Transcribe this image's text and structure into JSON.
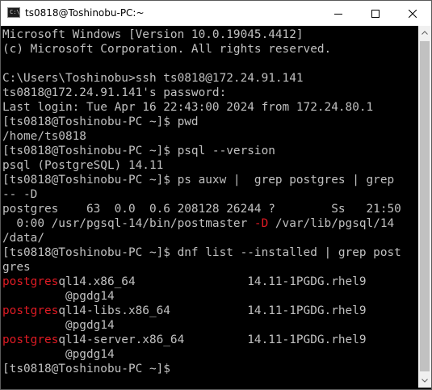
{
  "window": {
    "title": "ts0818@Toshinobu-PC:~",
    "icon_text": "C:\\",
    "controls": [
      "minimize-icon",
      "maximize-icon",
      "close-icon"
    ]
  },
  "colors": {
    "background": "#000000",
    "text": "#c0c0c0",
    "highlight": "#e01b24"
  },
  "terminal": {
    "lines": [
      [
        {
          "t": "Microsoft Windows [Version 10.0.19045.4412]"
        }
      ],
      [
        {
          "t": "(c) Microsoft Corporation. All rights reserved."
        }
      ],
      [
        {
          "t": ""
        }
      ],
      [
        {
          "t": "C:\\Users\\Toshinobu>ssh ts0818@172.24.91.141"
        }
      ],
      [
        {
          "t": "ts0818@172.24.91.141's password:"
        }
      ],
      [
        {
          "t": "Last login: Tue Apr 16 22:43:00 2024 from 172.24.80.1"
        }
      ],
      [
        {
          "t": "[ts0818@Toshinobu-PC ~]$ pwd"
        }
      ],
      [
        {
          "t": "/home/ts0818"
        }
      ],
      [
        {
          "t": "[ts0818@Toshinobu-PC ~]$ psql --version"
        }
      ],
      [
        {
          "t": "psql (PostgreSQL) 14.11"
        }
      ],
      [
        {
          "t": "[ts0818@Toshinobu-PC ~]$ ps auxw |  grep postgres | grep"
        }
      ],
      [
        {
          "t": "-- -D"
        }
      ],
      [
        {
          "t": "postgres    63  0.0  0.6 208128 26244 ?        Ss   21:50"
        }
      ],
      [
        {
          "t": "  0:00 /usr/pgsql-14/bin/postmaster "
        },
        {
          "t": "-D",
          "r": true
        },
        {
          "t": " /var/lib/pgsql/14"
        }
      ],
      [
        {
          "t": "/data/"
        }
      ],
      [
        {
          "t": "[ts0818@Toshinobu-PC ~]$ dnf list --installed | grep post"
        }
      ],
      [
        {
          "t": "gres"
        }
      ],
      [
        {
          "t": "postgres",
          "r": true
        },
        {
          "t": "ql14.x86_64                14.11-1PGDG.rhel9"
        }
      ],
      [
        {
          "t": "         @pgdg14"
        }
      ],
      [
        {
          "t": "postgres",
          "r": true
        },
        {
          "t": "ql14-libs.x86_64           14.11-1PGDG.rhel9"
        }
      ],
      [
        {
          "t": "         @pgdg14"
        }
      ],
      [
        {
          "t": "postgres",
          "r": true
        },
        {
          "t": "ql14-server.x86_64         14.11-1PGDG.rhel9"
        }
      ],
      [
        {
          "t": "         @pgdg14"
        }
      ],
      [
        {
          "t": "[ts0818@Toshinobu-PC ~]$"
        }
      ]
    ]
  }
}
